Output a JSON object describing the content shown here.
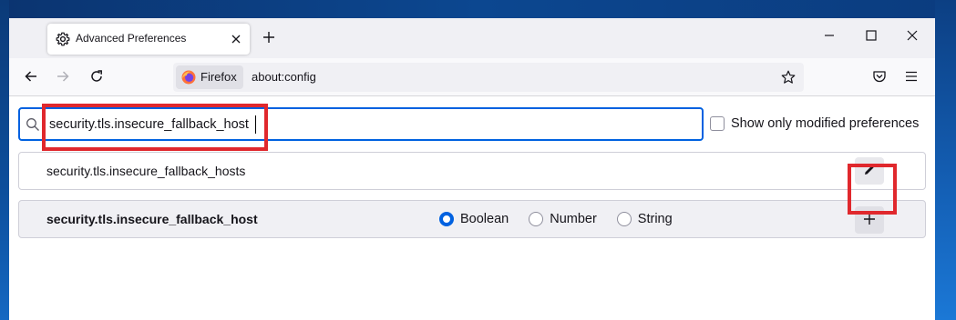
{
  "tab": {
    "title": "Advanced Preferences",
    "icon": "gear-icon",
    "close_icon": "close-icon"
  },
  "newtab": {
    "icon": "plus-icon"
  },
  "window_controls": {
    "minimize_icon": "minimize-icon",
    "maximize_icon": "maximize-icon",
    "close_icon": "close-icon"
  },
  "nav": {
    "back_icon": "back-arrow-icon",
    "forward_icon": "forward-arrow-icon",
    "reload_icon": "reload-icon",
    "identity_label": "Firefox",
    "url": "about:config",
    "bookmark_icon": "star-icon",
    "pocket_icon": "pocket-icon",
    "menu_icon": "hamburger-menu-icon"
  },
  "search": {
    "value": "security.tls.insecure_fallback_host",
    "icon": "search-icon"
  },
  "modified": {
    "label": "Show only modified preferences",
    "checked": false
  },
  "results": [
    {
      "name": "security.tls.insecure_fallback_hosts",
      "action_icon": "pencil-icon"
    }
  ],
  "new_pref": {
    "name": "security.tls.insecure_fallback_host",
    "types": [
      "Boolean",
      "Number",
      "String"
    ],
    "selected_type": "Boolean",
    "action_icon": "plus-icon"
  },
  "colors": {
    "accent": "#0061e0",
    "highlight": "#e0282d"
  }
}
